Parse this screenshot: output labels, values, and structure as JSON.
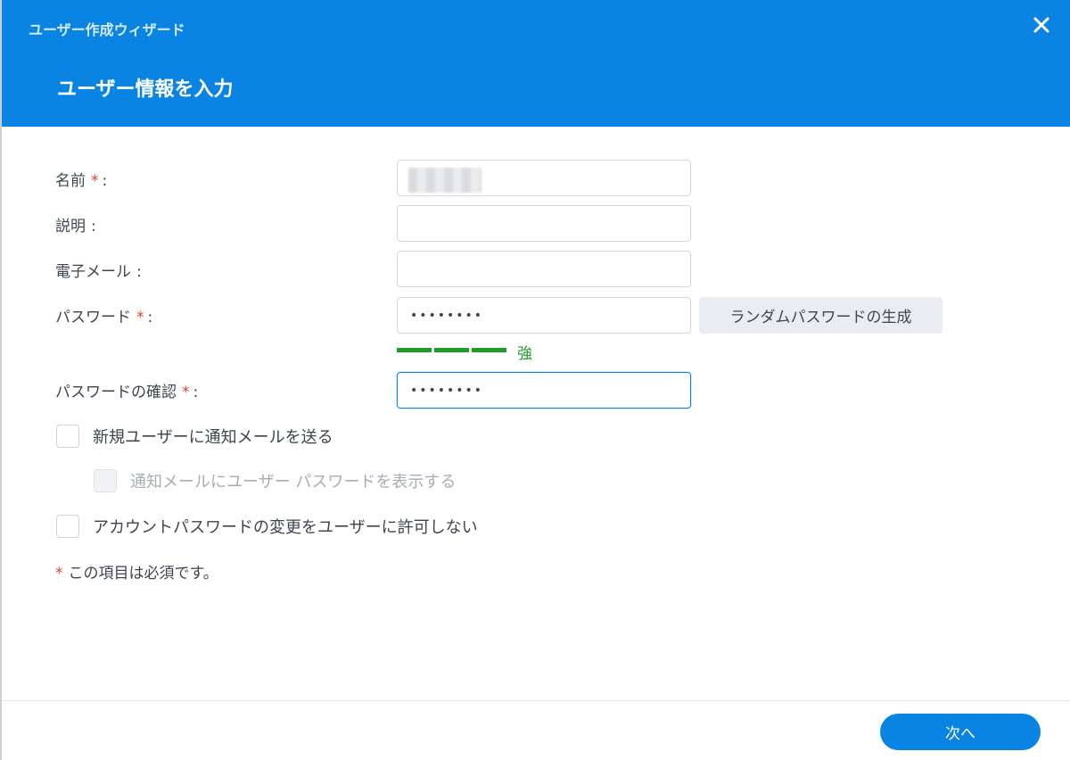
{
  "header": {
    "window_title": "ユーザー作成ウィザード",
    "step_title": "ユーザー情報を入力",
    "close_icon": "close-icon",
    "background": "#0a84e3"
  },
  "form": {
    "name": {
      "label": "名前",
      "required": "*",
      "colon": ":"
    },
    "description": {
      "label": "説明",
      "colon": ":",
      "value": ""
    },
    "email": {
      "label": "電子メール",
      "colon": ":",
      "value": ""
    },
    "password": {
      "label": "パスワード",
      "required": "*",
      "colon": ":",
      "value": "••••••••"
    },
    "generate_button": "ランダムパスワードの生成",
    "strength": {
      "label": "強",
      "level_fraction": 1.0,
      "color": "#1f9a2b"
    },
    "confirm_password": {
      "label": "パスワードの確認",
      "required": "*",
      "colon": ":",
      "value": "••••••••"
    }
  },
  "options": {
    "notify_email": {
      "label": "新規ユーザーに通知メールを送る",
      "checked": false
    },
    "show_password_in_email": {
      "label": "通知メールにユーザー パスワードを表示する",
      "checked": false,
      "disabled": true
    },
    "disallow_password_change": {
      "label": "アカウントパスワードの変更をユーザーに許可しない",
      "checked": false
    }
  },
  "note": {
    "star": "*",
    "text": "この項目は必須です。"
  },
  "footer": {
    "next_button": "次へ"
  },
  "colors": {
    "accent": "#0a84e3",
    "required": "#e53935",
    "strength": "#1f9a2b"
  }
}
